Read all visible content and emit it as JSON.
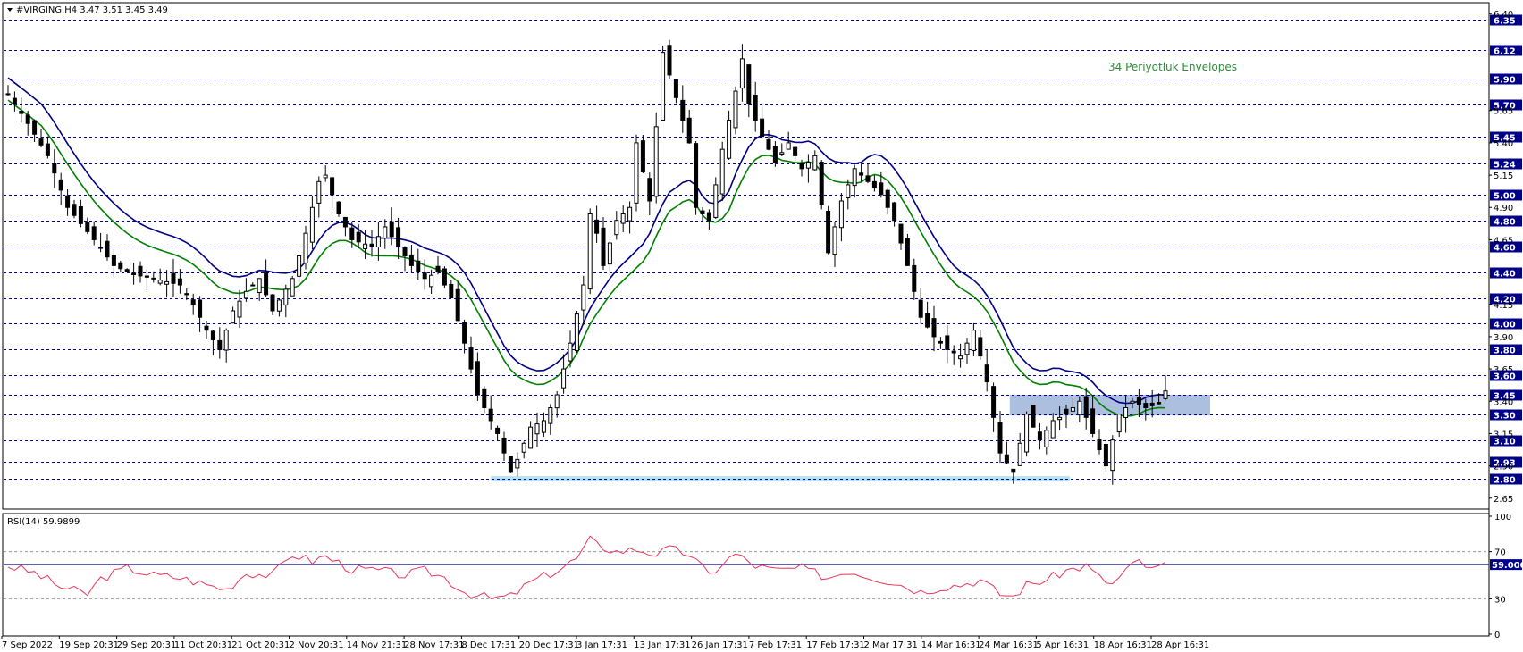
{
  "header": {
    "symbol_line": "#VIRGING,H4  3.47 3.51 3.45 3.49"
  },
  "indicator_label": "34 Periyotluk Envelopes",
  "rsi": {
    "label": "RSI(14) 59.9899",
    "level_badge": "59.0000",
    "axis_labels": [
      "100",
      "70",
      "30",
      "0"
    ]
  },
  "colors": {
    "envelope_upper": "#000080",
    "envelope_lower": "#008000",
    "rsi_line": "#e8365a",
    "level_line": "#00008b",
    "badge_bg": "#00008b",
    "zone_resistance": "#9fb4d8",
    "zone_support": "#a9dced",
    "candle": "#000000",
    "grid": "#00008b"
  },
  "chart_data": {
    "type": "candlestick",
    "ylim": [
      2.6,
      6.45
    ],
    "badge_levels": [
      "6.35",
      "6.12",
      "5.90",
      "5.70",
      "5.45",
      "5.24",
      "5.00",
      "4.80",
      "4.60",
      "4.40",
      "4.20",
      "4.00",
      "3.80",
      "3.60",
      "3.45",
      "3.30",
      "3.10",
      "2.93",
      "2.80"
    ],
    "plain_ticks": [
      "6.40",
      "5.65",
      "5.40",
      "5.15",
      "4.90",
      "4.65",
      "4.15",
      "3.90",
      "3.65",
      "3.40",
      "3.15",
      "2.90",
      "2.65"
    ],
    "x_labels": [
      "7 Sep 2022",
      "19 Sep 20:31",
      "29 Sep 20:31",
      "11 Oct 20:31",
      "21 Oct 20:31",
      "2 Nov 20:31",
      "14 Nov 21:31",
      "28 Nov 17:31",
      "8 Dec 17:31",
      "20 Dec 17:31",
      "3 Jan 17:31",
      "13 Jan 17:31",
      "26 Jan 17:31",
      "7 Feb 17:31",
      "17 Feb 17:31",
      "2 Mar 17:31",
      "14 Mar 16:31",
      "24 Mar 16:31",
      "5 Apr 16:31",
      "18 Apr 16:31",
      "28 Apr 16:31"
    ],
    "zones": [
      {
        "name": "resistance",
        "from": 3.29,
        "to": 3.45
      },
      {
        "name": "support",
        "from": 2.78,
        "to": 2.82
      }
    ],
    "price_anchors": [
      [
        0,
        5.78
      ],
      [
        3,
        5.55
      ],
      [
        6,
        5.3
      ],
      [
        9,
        4.9
      ],
      [
        13,
        4.65
      ],
      [
        16,
        4.45
      ],
      [
        19,
        4.38
      ],
      [
        22,
        4.35
      ],
      [
        26,
        4.3
      ],
      [
        28,
        4.15
      ],
      [
        30,
        3.95
      ],
      [
        32,
        3.8
      ],
      [
        34,
        4.1
      ],
      [
        36,
        4.25
      ],
      [
        38,
        4.35
      ],
      [
        40,
        4.1
      ],
      [
        43,
        4.35
      ],
      [
        45,
        4.7
      ],
      [
        47,
        5.1
      ],
      [
        48,
        5.15
      ],
      [
        50,
        4.85
      ],
      [
        52,
        4.65
      ],
      [
        55,
        4.6
      ],
      [
        57,
        4.75
      ],
      [
        59,
        4.6
      ],
      [
        61,
        4.45
      ],
      [
        63,
        4.35
      ],
      [
        65,
        4.4
      ],
      [
        67,
        4.2
      ],
      [
        69,
        3.85
      ],
      [
        71,
        3.45
      ],
      [
        73,
        3.25
      ],
      [
        74,
        3.15
      ],
      [
        76,
        2.85
      ],
      [
        77,
        2.95
      ],
      [
        79,
        3.2
      ],
      [
        81,
        3.25
      ],
      [
        83,
        3.45
      ],
      [
        85,
        3.85
      ],
      [
        87,
        4.3
      ],
      [
        88,
        4.85
      ],
      [
        89,
        4.7
      ],
      [
        90,
        4.45
      ],
      [
        92,
        4.8
      ],
      [
        94,
        4.9
      ],
      [
        95,
        5.4
      ],
      [
        97,
        4.95
      ],
      [
        99,
        6.1
      ],
      [
        101,
        5.75
      ],
      [
        103,
        5.4
      ],
      [
        104,
        4.9
      ],
      [
        106,
        4.8
      ],
      [
        108,
        5.35
      ],
      [
        110,
        5.8
      ],
      [
        111,
        6.05
      ],
      [
        112,
        5.7
      ],
      [
        114,
        5.45
      ],
      [
        116,
        5.25
      ],
      [
        118,
        5.4
      ],
      [
        120,
        5.2
      ],
      [
        122,
        5.3
      ],
      [
        124,
        4.55
      ],
      [
        126,
        4.95
      ],
      [
        128,
        5.2
      ],
      [
        130,
        5.1
      ],
      [
        132,
        5.0
      ],
      [
        134,
        4.8
      ],
      [
        136,
        4.45
      ],
      [
        138,
        4.05
      ],
      [
        140,
        3.9
      ],
      [
        142,
        3.8
      ],
      [
        144,
        3.75
      ],
      [
        146,
        3.95
      ],
      [
        148,
        3.55
      ],
      [
        150,
        3.0
      ],
      [
        152,
        2.85
      ],
      [
        154,
        3.3
      ],
      [
        156,
        3.1
      ],
      [
        158,
        3.25
      ],
      [
        160,
        3.3
      ],
      [
        162,
        3.4
      ],
      [
        164,
        3.15
      ],
      [
        166,
        2.9
      ],
      [
        168,
        3.3
      ],
      [
        170,
        3.4
      ],
      [
        172,
        3.35
      ],
      [
        174,
        3.38
      ],
      [
        175,
        3.48
      ]
    ],
    "rsi_anchors": [
      [
        0,
        58
      ],
      [
        4,
        52
      ],
      [
        8,
        40
      ],
      [
        12,
        34
      ],
      [
        14,
        47
      ],
      [
        18,
        56
      ],
      [
        22,
        50
      ],
      [
        26,
        48
      ],
      [
        30,
        42
      ],
      [
        33,
        38
      ],
      [
        36,
        52
      ],
      [
        40,
        50
      ],
      [
        43,
        68
      ],
      [
        46,
        62
      ],
      [
        48,
        66
      ],
      [
        52,
        55
      ],
      [
        56,
        54
      ],
      [
        60,
        50
      ],
      [
        63,
        54
      ],
      [
        66,
        48
      ],
      [
        69,
        36
      ],
      [
        73,
        30
      ],
      [
        76,
        32
      ],
      [
        79,
        44
      ],
      [
        83,
        54
      ],
      [
        86,
        64
      ],
      [
        88,
        80
      ],
      [
        89,
        76
      ],
      [
        92,
        70
      ],
      [
        95,
        72
      ],
      [
        98,
        68
      ],
      [
        100,
        72
      ],
      [
        103,
        68
      ],
      [
        106,
        50
      ],
      [
        108,
        60
      ],
      [
        110,
        68
      ],
      [
        113,
        58
      ],
      [
        116,
        54
      ],
      [
        120,
        56
      ],
      [
        124,
        48
      ],
      [
        127,
        54
      ],
      [
        131,
        48
      ],
      [
        134,
        44
      ],
      [
        138,
        36
      ],
      [
        141,
        40
      ],
      [
        144,
        42
      ],
      [
        147,
        46
      ],
      [
        150,
        34
      ],
      [
        152,
        32
      ],
      [
        154,
        42
      ],
      [
        157,
        46
      ],
      [
        160,
        54
      ],
      [
        163,
        58
      ],
      [
        165,
        48
      ],
      [
        167,
        42
      ],
      [
        169,
        54
      ],
      [
        171,
        62
      ],
      [
        173,
        54
      ],
      [
        175,
        60
      ]
    ]
  }
}
